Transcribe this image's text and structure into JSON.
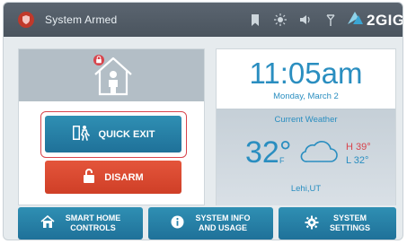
{
  "status_bar": {
    "status_text": "System Armed",
    "brand": "2GIG",
    "icons": [
      "alert-icon",
      "bookmark-icon",
      "sun-icon",
      "speaker-icon",
      "wifi-icon",
      "brand-logo-icon"
    ]
  },
  "security": {
    "quick_exit_label": "QUICK EXIT",
    "disarm_label": "DISARM"
  },
  "clock": {
    "time": "11:05am",
    "date": "Monday, March 2"
  },
  "weather": {
    "title": "Current Weather",
    "temperature": "32°",
    "unit": "F",
    "high": "H 39°",
    "low": "L 32°",
    "city": "Lehi,UT"
  },
  "bottom_nav": {
    "smart_home": [
      "SMART HOME",
      "CONTROLS"
    ],
    "system_info": [
      "SYSTEM INFO",
      "AND USAGE"
    ],
    "system_settings": [
      "SYSTEM",
      "SETTINGS"
    ]
  },
  "colors": {
    "accent_blue": "#2a8ec0",
    "button_blue": "#1f7199",
    "alert_red": "#d8444c",
    "disarm_orange": "#cf3f27",
    "status_bar": "#4a545e"
  }
}
